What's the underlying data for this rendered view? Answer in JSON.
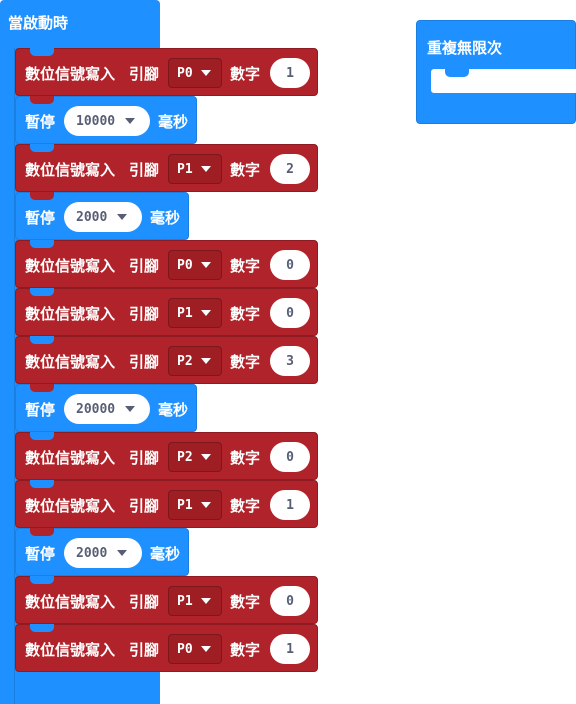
{
  "on_start": {
    "label": "當啟動時"
  },
  "forever": {
    "label": "重複無限次"
  },
  "strings": {
    "digital_write": "數位信號寫入",
    "pin": "引腳",
    "value": "數字",
    "pause": "暫停",
    "ms": "毫秒"
  },
  "blocks": [
    {
      "type": "digital_write",
      "pin": "P0",
      "value": "1"
    },
    {
      "type": "pause",
      "ms": "10000"
    },
    {
      "type": "digital_write",
      "pin": "P1",
      "value": "2"
    },
    {
      "type": "pause",
      "ms": "2000"
    },
    {
      "type": "digital_write",
      "pin": "P0",
      "value": "0"
    },
    {
      "type": "digital_write",
      "pin": "P1",
      "value": "0"
    },
    {
      "type": "digital_write",
      "pin": "P2",
      "value": "3"
    },
    {
      "type": "pause",
      "ms": "20000"
    },
    {
      "type": "digital_write",
      "pin": "P2",
      "value": "0"
    },
    {
      "type": "digital_write",
      "pin": "P1",
      "value": "1"
    },
    {
      "type": "pause",
      "ms": "2000"
    },
    {
      "type": "digital_write",
      "pin": "P1",
      "value": "0"
    },
    {
      "type": "digital_write",
      "pin": "P0",
      "value": "1"
    }
  ],
  "colors": {
    "pins_red": "#b0232a",
    "control_blue": "#1e90ff",
    "field_text": "#575e75"
  },
  "icons": {
    "dropdown": "caret-down-icon"
  }
}
